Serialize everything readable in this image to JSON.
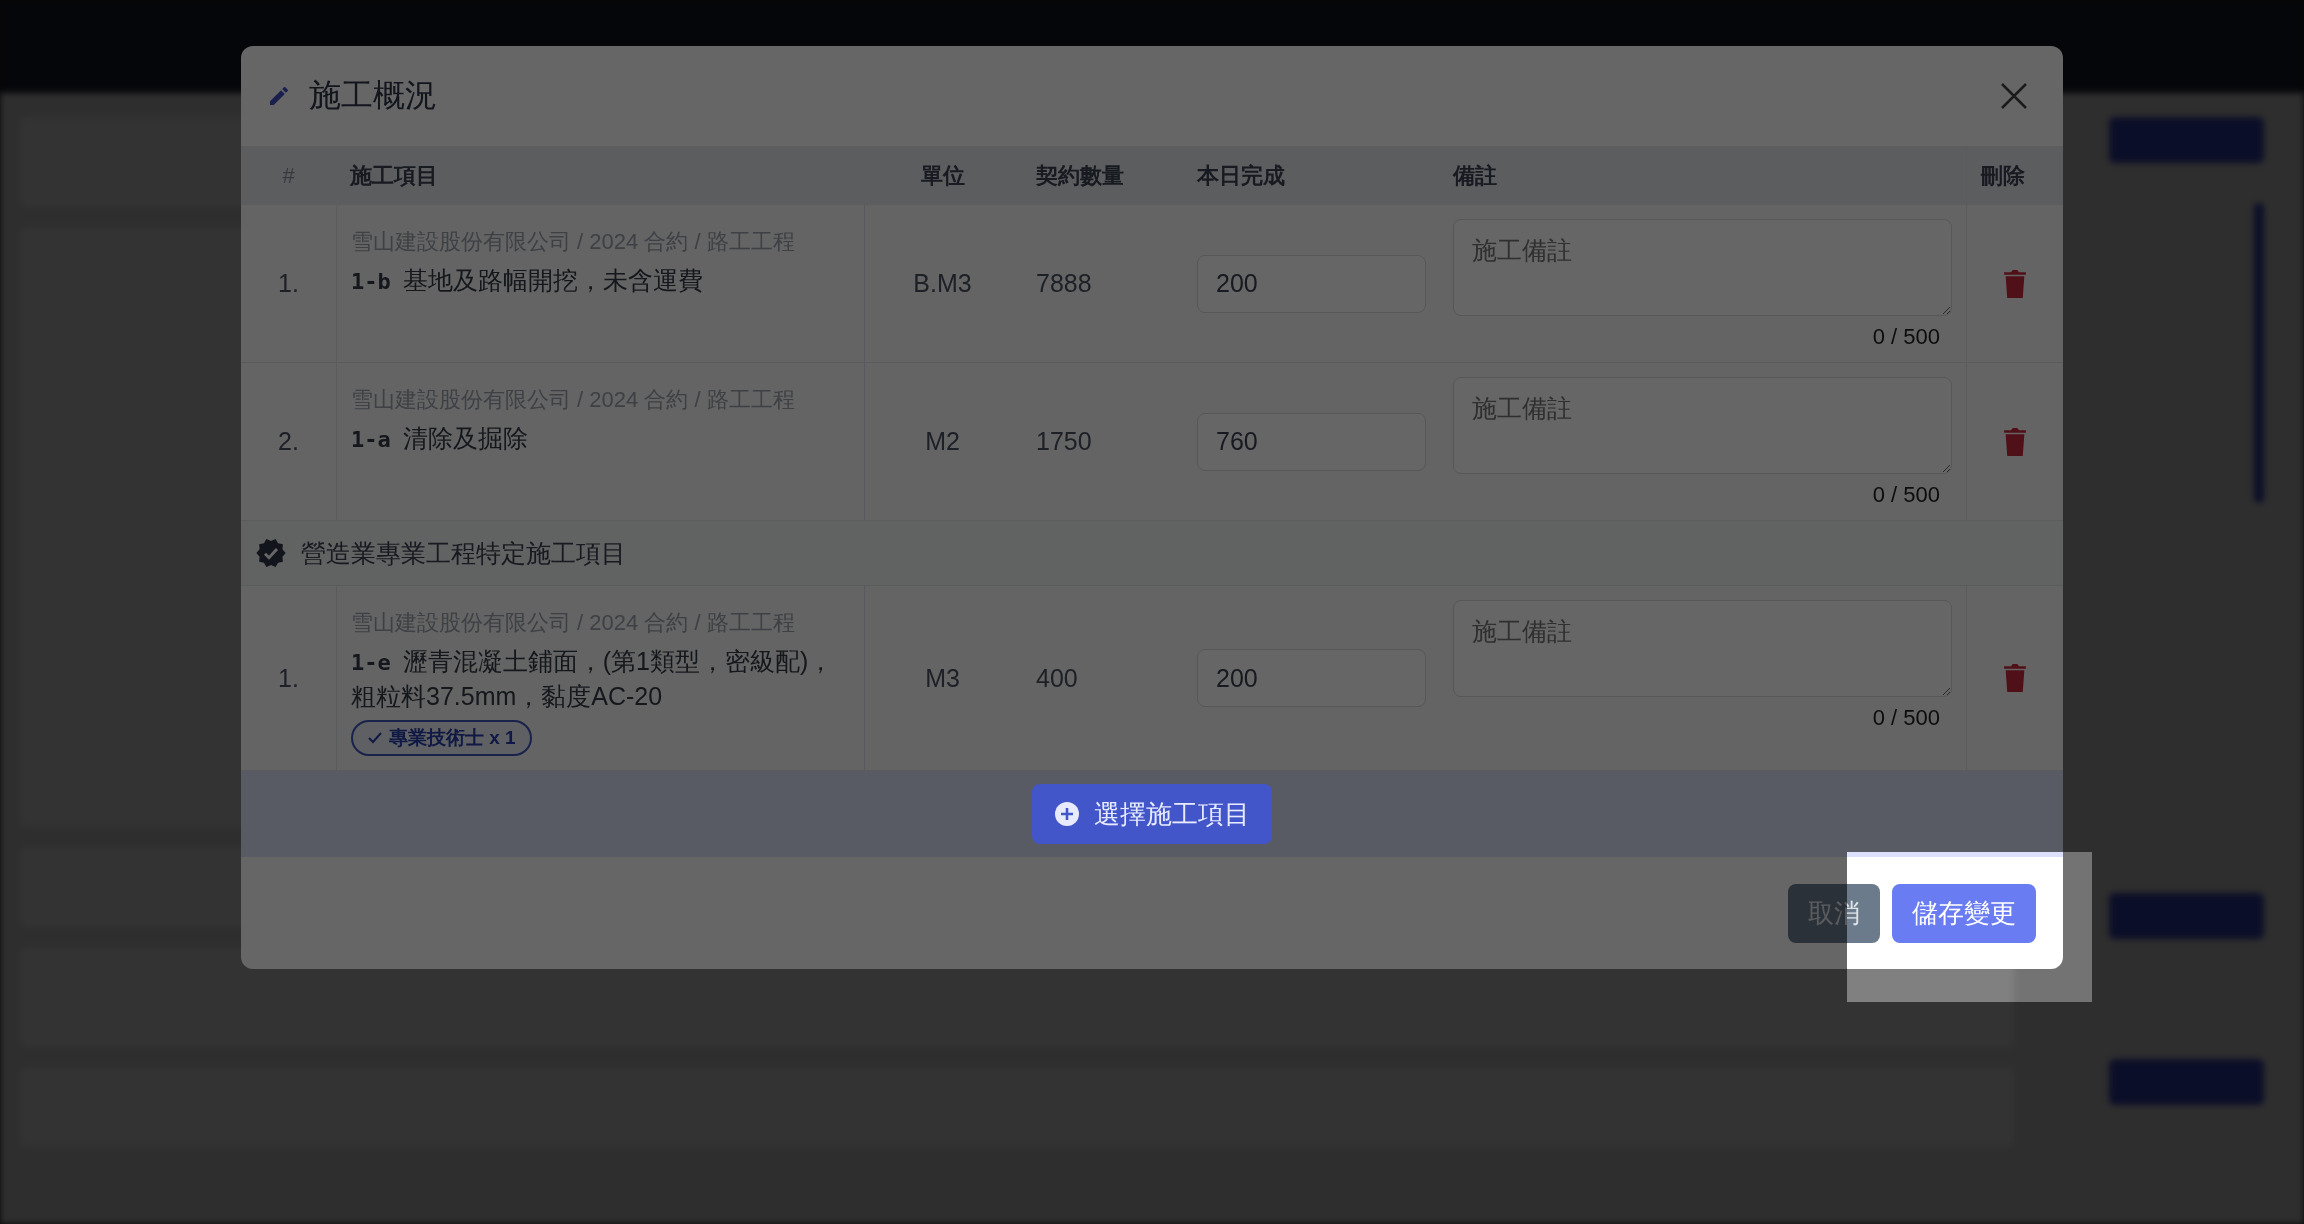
{
  "dialog": {
    "title": "施工概況"
  },
  "table": {
    "columns": [
      "#",
      "施工項目",
      "單位",
      "契約數量",
      "本日完成",
      "備註",
      "刪除"
    ],
    "rows": [
      {
        "kind": "item",
        "index": "1.",
        "path": "雪山建設股份有限公司 / 2024 合約 / 路工工程",
        "code": "1-b",
        "name": "基地及路幅開挖，未含運費",
        "unit": "B.M3",
        "contract_qty": "7888",
        "done_today": "200",
        "note_placeholder": "施工備註",
        "counter": "0 / 500"
      },
      {
        "kind": "item",
        "index": "2.",
        "path": "雪山建設股份有限公司 / 2024 合約 / 路工工程",
        "code": "1-a",
        "name": "清除及掘除",
        "unit": "M2",
        "contract_qty": "1750",
        "done_today": "760",
        "note_placeholder": "施工備註",
        "counter": "0 / 500"
      },
      {
        "kind": "group",
        "title": "營造業專業工程特定施工項目"
      },
      {
        "kind": "item",
        "index": "1.",
        "path": "雪山建設股份有限公司 / 2024 合約 / 路工工程",
        "code": "1-e",
        "name": "瀝青混凝土鋪面，(第1類型，密級配)，粗粒料37.5mm，黏度AC-20",
        "unit": "M3",
        "contract_qty": "400",
        "done_today": "200",
        "note_placeholder": "施工備註",
        "counter": "0 / 500",
        "tags": [
          "專業技術士 x 1"
        ]
      }
    ]
  },
  "add_button": {
    "label": "選擇施工項目"
  },
  "footer_buttons": [
    {
      "label": "取消",
      "kind": "secondary"
    },
    {
      "label": "儲存變更",
      "kind": "primary"
    }
  ],
  "tour_overlay": true
}
